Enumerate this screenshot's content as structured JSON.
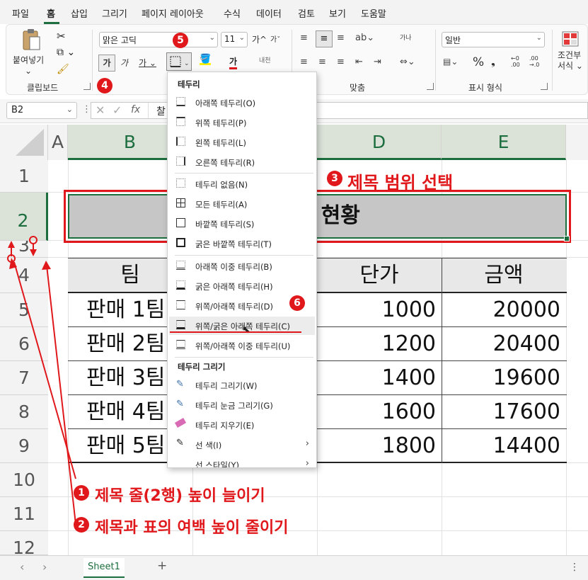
{
  "menu_tabs": [
    "파일",
    "홈",
    "삽입",
    "그리기",
    "페이지 레이아웃",
    "수식",
    "데이터",
    "검토",
    "보기",
    "도움말"
  ],
  "ribbon": {
    "clipboard": {
      "paste_label": "붙여넣기",
      "group_label": "클립보드"
    },
    "font": {
      "font_name": "맑은 고딕",
      "font_size": "11",
      "grow_label": "가",
      "bold_label": "가",
      "italic_label": "가",
      "underline_label": "가",
      "fontcolor_label": "가",
      "phonetic_label": "내천"
    },
    "alignment": {
      "group_label": "맞춤",
      "wrap_label": "가나"
    },
    "number": {
      "format": "일반",
      "group_label": "표시 형식",
      "percent": "%"
    },
    "styles": {
      "cond_label_1": "조건부",
      "cond_label_2": "서식"
    }
  },
  "formula_bar": {
    "name_box": "B2",
    "formula_text": "찰",
    "fx": "fx"
  },
  "grid": {
    "columns": [
      "A",
      "B",
      "C",
      "D",
      "E"
    ],
    "rows": [
      "1",
      "2",
      "3",
      "4",
      "5",
      "6",
      "7",
      "8",
      "9",
      "10",
      "11",
      "12"
    ],
    "title_cell": "판매 현황",
    "header_team": "팀",
    "header_price": "단가",
    "header_amount": "금액",
    "teams": [
      "판매 1팀",
      "판매 2팀",
      "판매 3팀",
      "판매 4팀",
      "판매 5팀"
    ],
    "prices": [
      "1000",
      "1200",
      "1400",
      "1600",
      "1800"
    ],
    "amounts": [
      "20000",
      "20400",
      "19600",
      "17600",
      "14400"
    ]
  },
  "border_menu": {
    "header": "테두리",
    "items": [
      "아래쪽 테두리(O)",
      "위쪽 테두리(P)",
      "왼쪽 테두리(L)",
      "오른쪽 테두리(R)",
      "테두리 없음(N)",
      "모든 테두리(A)",
      "바깥쪽 테두리(S)",
      "굵은 바깥쪽 테두리(T)",
      "아래쪽 이중 테두리(B)",
      "굵은 아래쪽 테두리(H)",
      "위쪽/아래쪽 테두리(D)",
      "위쪽/굵은 아래쪽 테두리(C)",
      "위쪽/아래쪽 이중 테두리(U)"
    ],
    "draw_header": "테두리 그리기",
    "draw_items": [
      "테두리 그리기(W)",
      "테두리 눈금 그리기(G)",
      "테두리 지우기(E)",
      "선 색(I)",
      "선 스타일(Y)"
    ]
  },
  "annotations": {
    "step1": "제목 줄(2행) 높이 늘이기",
    "step2": "제목과 표의 여백 높이 줄이기",
    "step3": "제목 범위 선택",
    "badges": [
      "1",
      "2",
      "3",
      "4",
      "5",
      "6"
    ]
  },
  "sheet_tab": "Sheet1",
  "colors": {
    "accent_green": "#1d6e3f",
    "annotation_red": "#e0181b",
    "selection_fill": "#c6c6c6",
    "header_fill": "#e8e8e8"
  }
}
